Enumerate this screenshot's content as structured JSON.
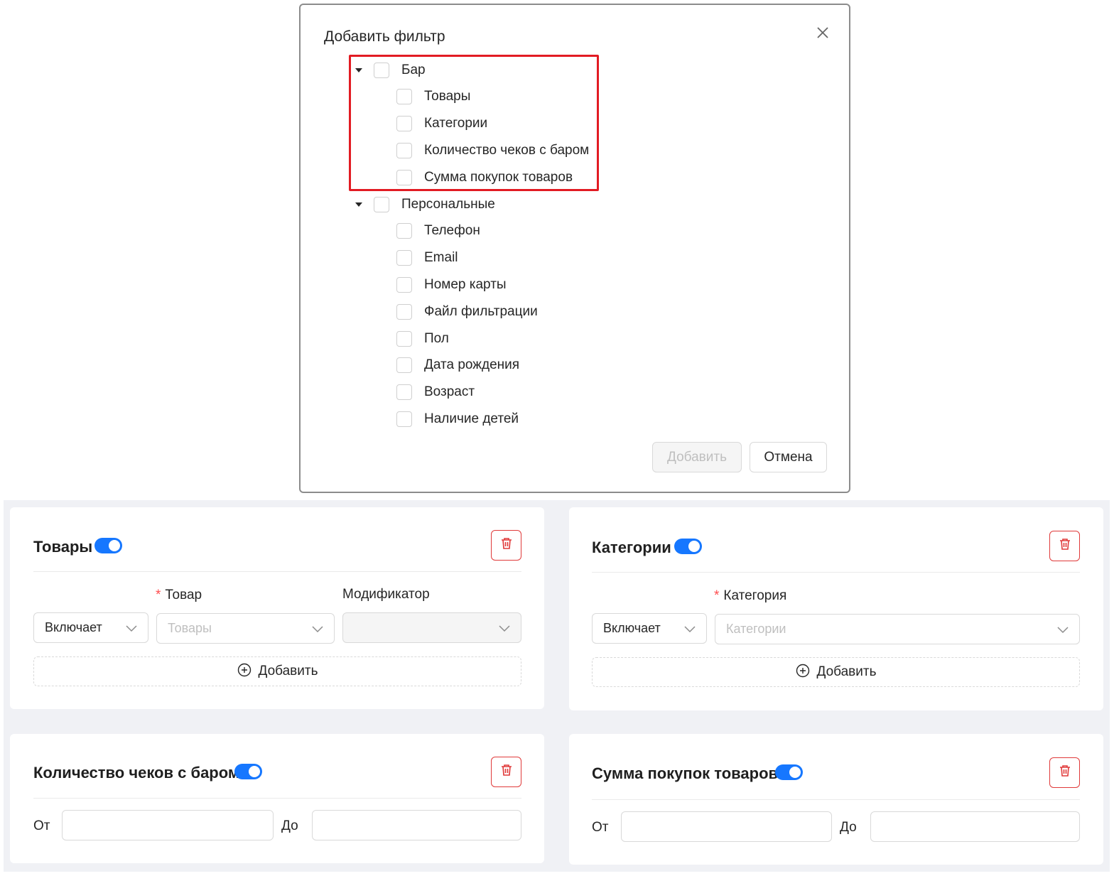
{
  "modal": {
    "title": "Добавить фильтр",
    "groups": [
      {
        "label": "Бар",
        "items": [
          "Товары",
          "Категории",
          "Количество чеков с баром",
          "Сумма покупок товаров"
        ]
      },
      {
        "label": "Персональные",
        "items": [
          "Телефон",
          "Email",
          "Номер карты",
          "Файл фильтрации",
          "Пол",
          "Дата рождения",
          "Возраст",
          "Наличие детей"
        ]
      }
    ],
    "add_button": "Добавить",
    "cancel_button": "Отмена"
  },
  "cards": {
    "products": {
      "title": "Товары",
      "enabled": true,
      "required_mark": "*",
      "product_label": "Товар",
      "modifier_label": "Модификатор",
      "condition_value": "Включает",
      "product_placeholder": "Товары",
      "add_label": "Добавить"
    },
    "categories": {
      "title": "Категории",
      "enabled": true,
      "required_mark": "*",
      "category_label": "Категория",
      "condition_value": "Включает",
      "category_placeholder": "Категории",
      "add_label": "Добавить"
    },
    "receipts": {
      "title": "Количество чеков с баром",
      "enabled": true,
      "from_label": "От",
      "to_label": "До"
    },
    "purchases_sum": {
      "title": "Сумма покупок товаров",
      "enabled": true,
      "from_label": "От",
      "to_label": "До"
    }
  },
  "colors": {
    "accent": "#1677ff",
    "danger": "#e03a3a",
    "highlight": "#e21b23",
    "background": "#f0f1f5"
  }
}
